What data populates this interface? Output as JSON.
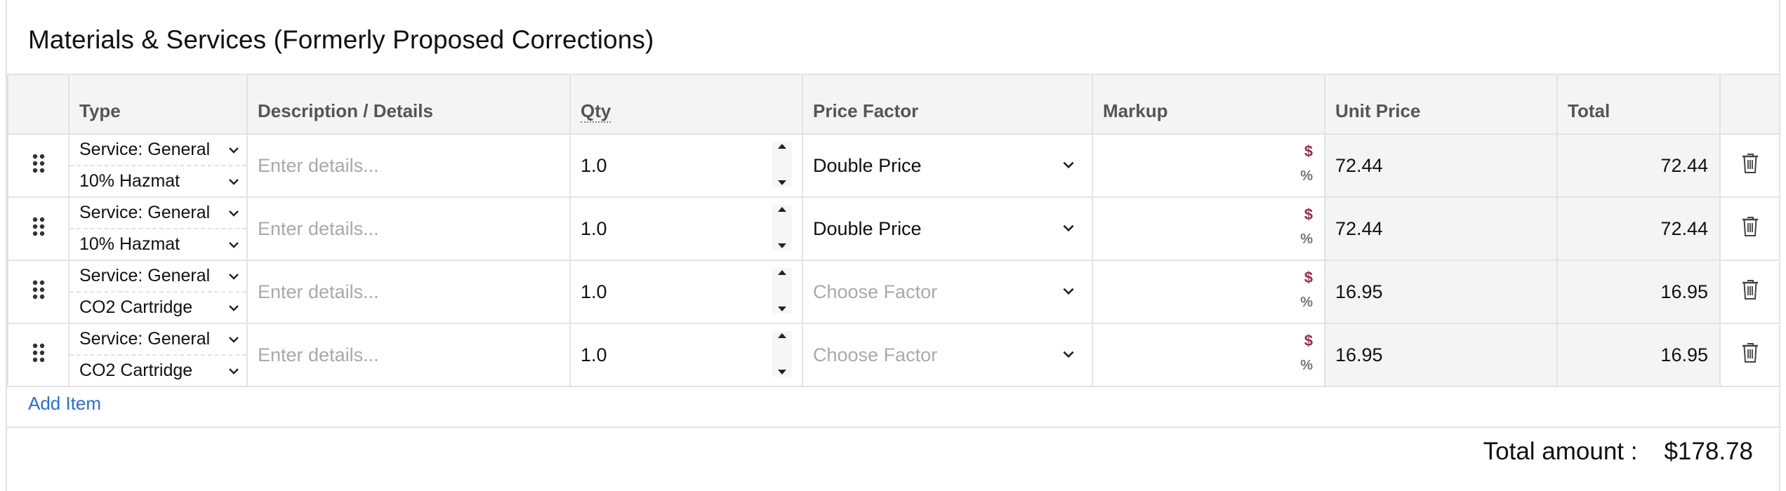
{
  "section": {
    "title": "Materials & Services (Formerly Proposed Corrections)"
  },
  "table": {
    "columns": {
      "type": "Type",
      "description": "Description / Details",
      "qty": "Qty",
      "price_factor": "Price Factor",
      "markup": "Markup",
      "unit_price": "Unit Price",
      "total": "Total"
    },
    "rows": [
      {
        "type": "Service: General",
        "subtype": "10% Hazmat",
        "description_placeholder": "Enter details...",
        "qty": "1.0",
        "price_factor": "Double Price",
        "markup_dollar": "$",
        "markup_pct": "%",
        "unit_price": "72.44",
        "total": "72.44"
      },
      {
        "type": "Service: General",
        "subtype": "10% Hazmat",
        "description_placeholder": "Enter details...",
        "qty": "1.0",
        "price_factor": "Double Price",
        "markup_dollar": "$",
        "markup_pct": "%",
        "unit_price": "72.44",
        "total": "72.44"
      },
      {
        "type": "Service: General",
        "subtype": "CO2 Cartridge",
        "description_placeholder": "Enter details...",
        "qty": "1.0",
        "price_factor": "Choose Factor",
        "markup_dollar": "$",
        "markup_pct": "%",
        "unit_price": "16.95",
        "total": "16.95"
      },
      {
        "type": "Service: General",
        "subtype": "CO2 Cartridge",
        "description_placeholder": "Enter details...",
        "qty": "1.0",
        "price_factor": "Choose Factor",
        "markup_dollar": "$",
        "markup_pct": "%",
        "unit_price": "16.95",
        "total": "16.95"
      }
    ]
  },
  "actions": {
    "add_item": "Add Item"
  },
  "summary": {
    "total_label": "Total amount :",
    "total_value": "$178.78"
  },
  "colors": {
    "accent_link": "#2d6fc6",
    "markup_dollar": "#9b2c4a",
    "header_bg": "#f4f4f4",
    "border": "#e3e3e3"
  },
  "icons": [
    "drag-handle-icon",
    "chevron-down-icon",
    "spinner-up-icon",
    "spinner-down-icon",
    "trash-icon"
  ]
}
